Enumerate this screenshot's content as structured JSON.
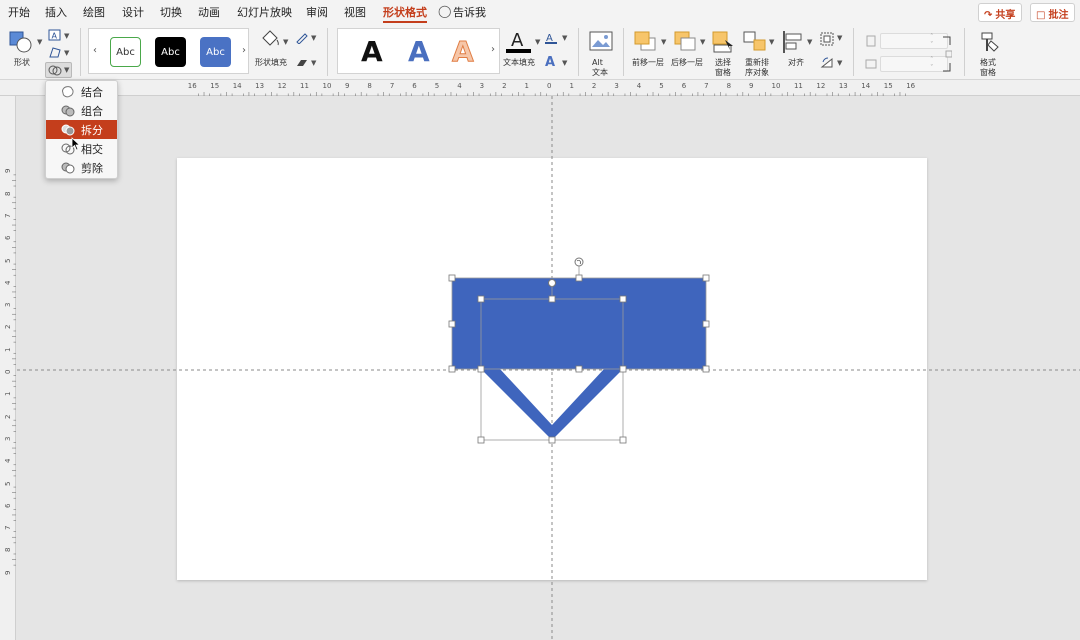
{
  "menu_tabs": [
    "开始",
    "插入",
    "绘图",
    "设计",
    "切换",
    "动画",
    "幻灯片放映",
    "审阅",
    "视图",
    "形状格式",
    "告诉我"
  ],
  "active_tab": "形状格式",
  "share_label": "共享",
  "comments_label": "批注",
  "ribbon": {
    "shape_label": "形状",
    "style_gallery": [
      "Abc",
      "Abc",
      "Abc"
    ],
    "shape_fill_label": "形状填充",
    "wordart_glyphs": [
      "A",
      "A",
      "A"
    ],
    "text_fill_label": "文本填充",
    "alt_text_label": [
      "Alt",
      "文本"
    ],
    "bring_forward_label": "前移一层",
    "send_backward_label": "后移一层",
    "selection_pane_label": [
      "选择",
      "窗格"
    ],
    "reorder_label": [
      "重新排",
      "序对象"
    ],
    "align_label": "对齐",
    "format_pane_label": [
      "格式",
      "窗格"
    ]
  },
  "merge_menu": {
    "items": [
      "结合",
      "组合",
      "拆分",
      "相交",
      "剪除"
    ],
    "selected": "拆分"
  },
  "ruler": {
    "horizontal": [
      "16",
      "15",
      "14",
      "13",
      "12",
      "11",
      "10",
      "9",
      "8",
      "7",
      "6",
      "5",
      "4",
      "3",
      "2",
      "1",
      "0",
      "1",
      "2",
      "3",
      "4",
      "5",
      "6",
      "7",
      "8",
      "9",
      "10",
      "11",
      "12",
      "13",
      "14",
      "15",
      "16"
    ],
    "vertical": [
      "9",
      "8",
      "7",
      "6",
      "5",
      "4",
      "3",
      "2",
      "1",
      "0",
      "1",
      "2",
      "3",
      "4",
      "5",
      "6",
      "7",
      "8",
      "9"
    ]
  },
  "colors": {
    "accent": "#c43e1c",
    "shape_blue": "#3f65bd",
    "wordart_blue": "#4a6fbf",
    "wordart_orange": "#f0a070",
    "handle_border": "#8a8a8a"
  }
}
